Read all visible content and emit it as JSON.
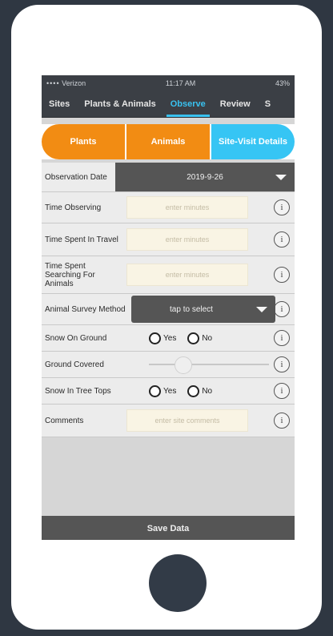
{
  "status": {
    "carrier": "Verizon",
    "time": "11:17 AM",
    "battery": "43%"
  },
  "nav": {
    "tabs": [
      "Sites",
      "Plants & Animals",
      "Observe",
      "Review",
      "S"
    ],
    "active_index": 2
  },
  "segment": {
    "plants": "Plants",
    "animals": "Animals",
    "site_visit": "Site-Visit Details"
  },
  "form": {
    "observation_date": {
      "label": "Observation Date",
      "value": "2019-9-26"
    },
    "time_observing": {
      "label": "Time Observing",
      "placeholder": "enter minutes"
    },
    "time_travel": {
      "label": "Time Spent In Travel",
      "placeholder": "enter minutes"
    },
    "time_searching": {
      "label": "Time Spent Searching For Animals",
      "placeholder": "enter minutes"
    },
    "survey_method": {
      "label": "Animal Survey Method",
      "value": "tap to select"
    },
    "snow_ground": {
      "label": "Snow On Ground",
      "yes": "Yes",
      "no": "No"
    },
    "ground_covered": {
      "label": "Ground Covered",
      "value": 0.25
    },
    "snow_trees": {
      "label": "Snow In Tree Tops",
      "yes": "Yes",
      "no": "No"
    },
    "comments": {
      "label": "Comments",
      "placeholder": "enter site comments"
    }
  },
  "save_label": "Save Data",
  "info_glyph": "i",
  "colors": {
    "orange": "#f28c13",
    "blue": "#36c5f4",
    "dark": "#3b3f45"
  }
}
